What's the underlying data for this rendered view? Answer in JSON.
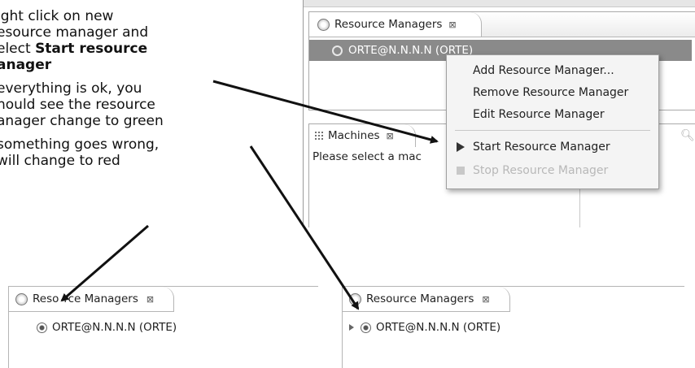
{
  "instructions": {
    "step1_prefix": "ight click on new",
    "step1_line2": "esource manager and",
    "step1_line3_prefix": "elect ",
    "step1_bold_line1": "Start resource",
    "step1_bold_line2": "anager",
    "step2_line1": " everything is ok, you",
    "step2_line2": "hould see the resource",
    "step2_line3": "anager change to green",
    "step3_line1": " something goes wrong,",
    "step3_line2": " will change to red"
  },
  "resource_view": {
    "tab_label": "Resource Managers",
    "close_glyph": "⊠",
    "selected_item": "ORTE@N.N.N.N (ORTE)"
  },
  "machines_view": {
    "tab_label": "Machines",
    "close_glyph": "⊠",
    "prompt": "Please select a mac"
  },
  "context_menu": {
    "items": [
      "Add Resource Manager...",
      "Remove Resource Manager",
      "Edit Resource Manager",
      "Start Resource Manager",
      "Stop Resource Manager"
    ]
  },
  "bottom_left": {
    "tab_label": "Reso",
    "tab_label_rest": "rce Managers",
    "close_glyph": "⊠",
    "item": "ORTE@N.N.N.N (ORTE)"
  },
  "bottom_right": {
    "tab_label": "Resource Managers",
    "close_glyph": "⊠",
    "item": "ORTE@N.N.N.N (ORTE)"
  }
}
